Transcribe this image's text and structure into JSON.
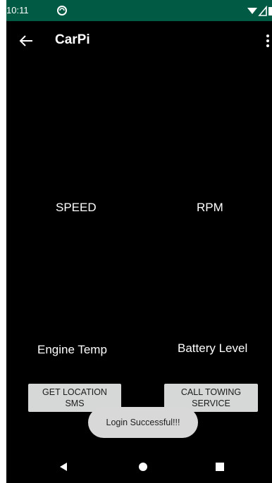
{
  "status_bar": {
    "time": "10:11",
    "background_color": "#005a44"
  },
  "app_bar": {
    "title": "CarPi",
    "back_icon": "arrow-left-icon",
    "overflow_icon": "more-vert-icon"
  },
  "gauges": {
    "speed_label": "SPEED",
    "rpm_label": "RPM",
    "engine_temp_label": "Engine Temp",
    "battery_level_label": "Battery Level"
  },
  "buttons": {
    "location_line1": "GET LOCATION",
    "location_line2": "SMS",
    "towing_line1": "CALL TOWING",
    "towing_line2": "SERVICE"
  },
  "toast": {
    "message": "Login Successful!!!"
  },
  "nav_bar": {
    "back_icon": "triangle-back-icon",
    "home_icon": "circle-home-icon",
    "recents_icon": "square-recents-icon"
  },
  "colors": {
    "screen_background": "#000000",
    "button_background": "#d6d7d7",
    "toast_background": "#d8d8d8"
  }
}
